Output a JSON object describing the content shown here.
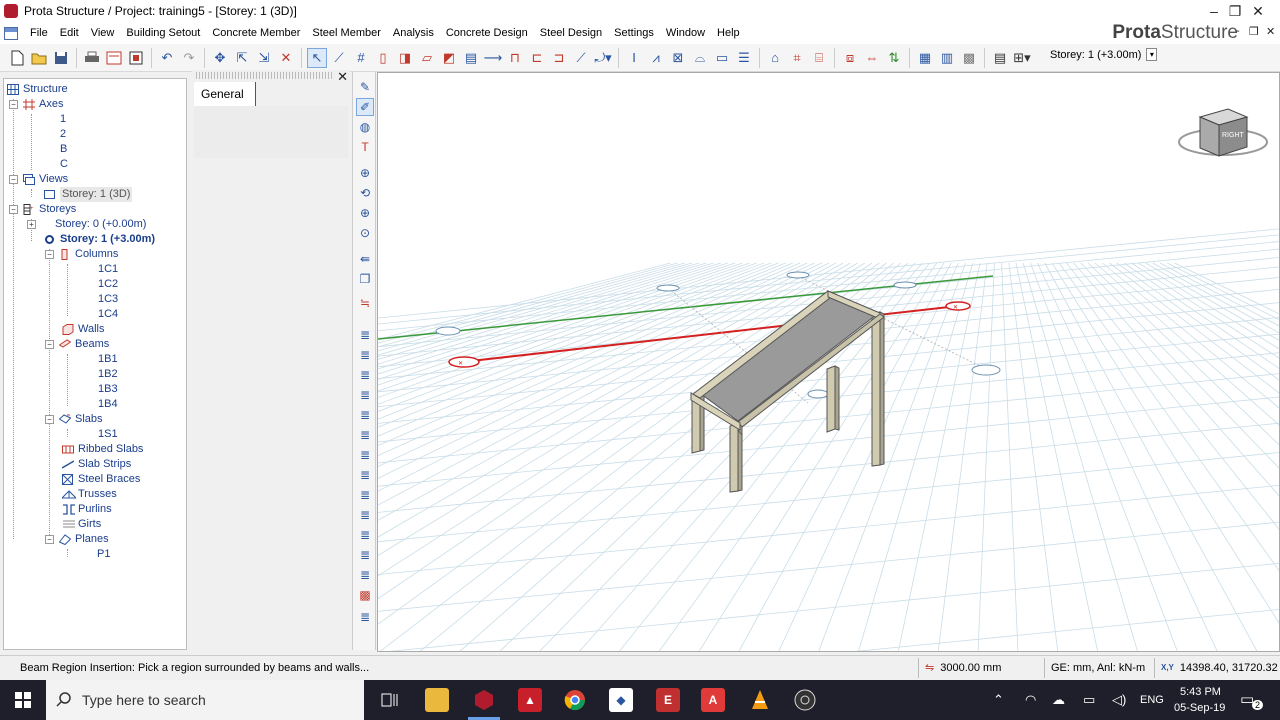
{
  "window": {
    "title": "Prota Structure / Project: training5 - [Storey: 1 (3D)]",
    "controls": [
      "–",
      "❐",
      "✕"
    ]
  },
  "menu": {
    "items": [
      "File",
      "Edit",
      "View",
      "Building Setout",
      "Concrete Member",
      "Steel Member",
      "Analysis",
      "Concrete Design",
      "Steel Design",
      "Settings",
      "Window",
      "Help"
    ],
    "brand_bold": "Prota",
    "brand_rest": "Structure",
    "mdi_controls": [
      "-",
      "❐",
      "✕"
    ]
  },
  "toolbar": {
    "storey_selector": "Storey: 1 (+3.00m)"
  },
  "tree": {
    "structure": "Structure",
    "axes": "Axes",
    "axis_items": [
      "1",
      "2",
      "B",
      "C"
    ],
    "views": "Views",
    "view_items": [
      "Storey: 1 (3D)"
    ],
    "storeys": "Storeys",
    "storey0": "Storey: 0 (+0.00m)",
    "storey1": "Storey: 1 (+3.00m)",
    "columns": "Columns",
    "column_items": [
      "1C1",
      "1C2",
      "1C3",
      "1C4"
    ],
    "walls": "Walls",
    "beams": "Beams",
    "beam_items": [
      "1B1",
      "1B2",
      "1B3",
      "1B4"
    ],
    "slabs": "Slabs",
    "slab_items": [
      "1S1"
    ],
    "ribbed_slabs": "Ribbed Slabs",
    "slab_strips": "Slab Strips",
    "steel_braces": "Steel Braces",
    "trusses": "Trusses",
    "purlins": "Purlins",
    "girts": "Girts",
    "planes": "Planes",
    "plane_items": [
      "P1"
    ]
  },
  "properties": {
    "tab": "General",
    "close": "✕"
  },
  "viewcube": {
    "face_label": "RIGHT"
  },
  "status": {
    "message": "Beam Region Insertion: Pick a region surrounded by beams and walls...",
    "snap_distance": "3000.00 mm",
    "units": "GE: mm,  Anl: kN-m",
    "coord_label": "X,Y",
    "coordinates": "14398.40, 31720.32"
  },
  "taskbar": {
    "search_placeholder": "Type here to search",
    "language": "ENG",
    "time": "5:43 PM",
    "date": "05-Sep-19",
    "notifications": "2"
  },
  "colors": {
    "axis_red": "#d42020",
    "axis_green": "#3a9a3a",
    "slab_grey": "#9a9a9a",
    "column_beige": "#cfcab0",
    "tree_blue": "#1a3d8c",
    "taskbar_bg": "#1f1f2b"
  }
}
